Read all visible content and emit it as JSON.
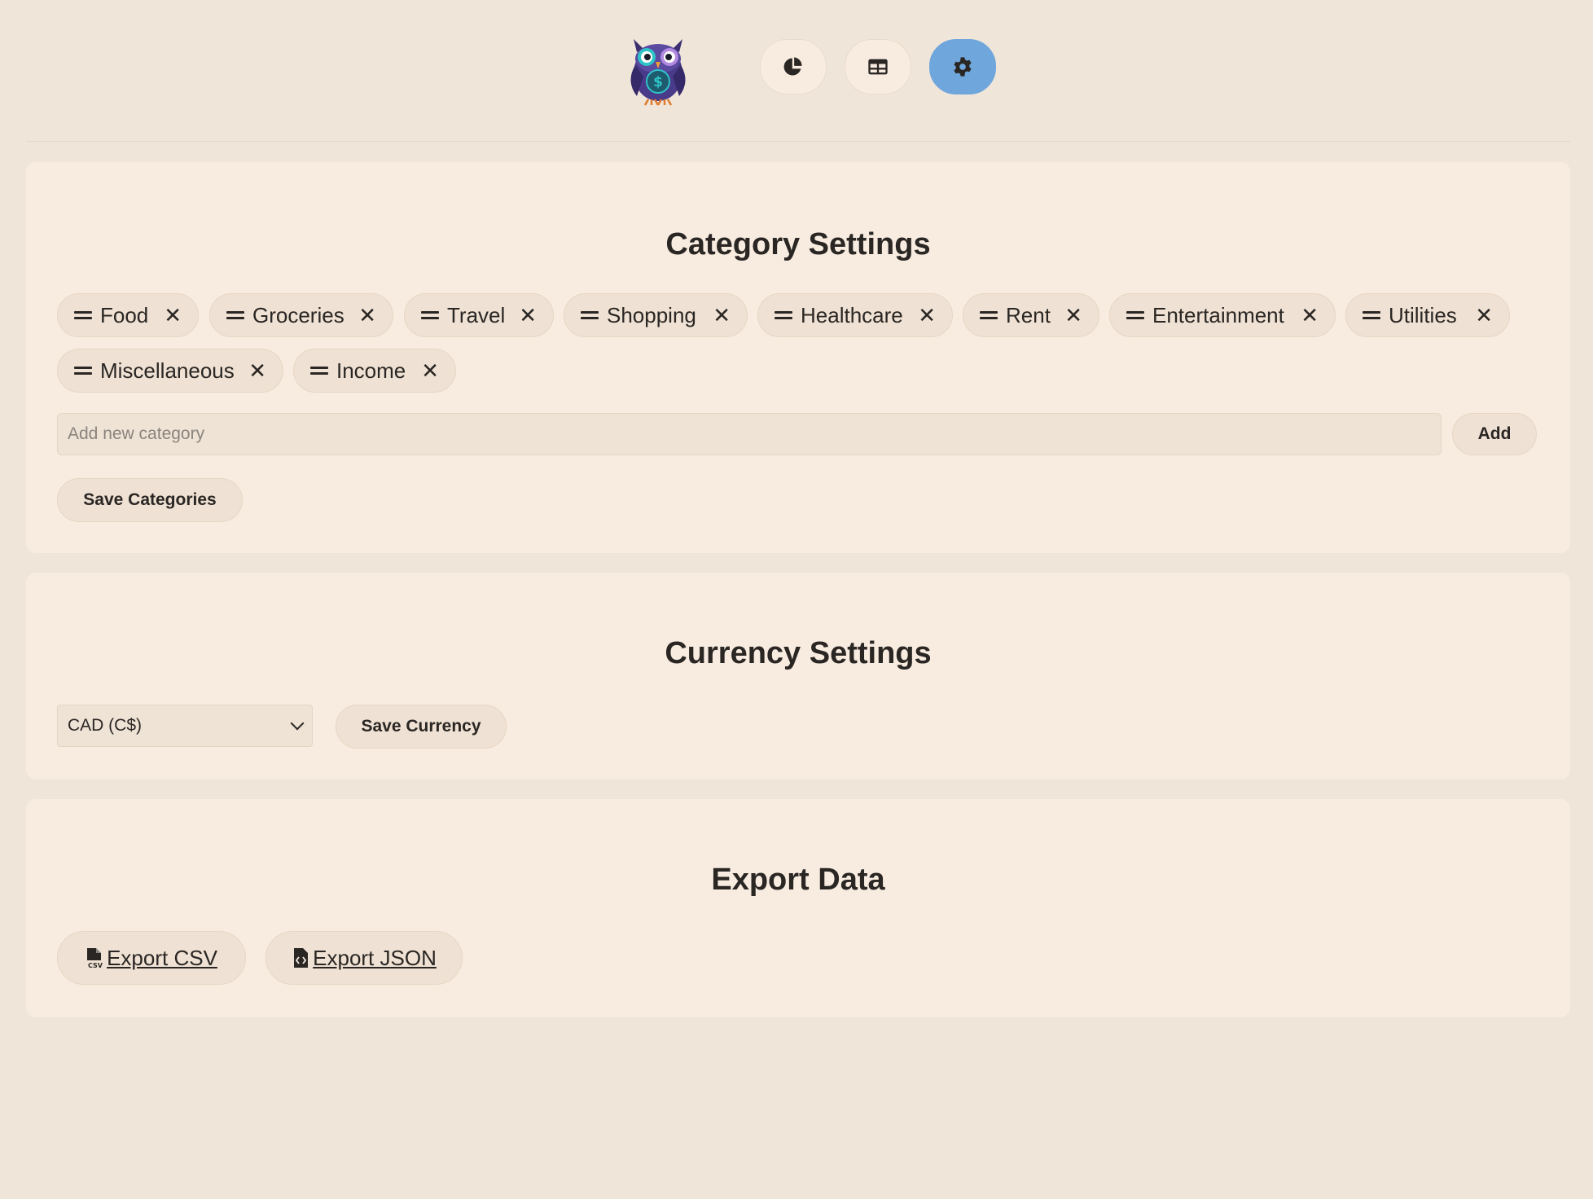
{
  "nav": {
    "items": [
      {
        "name": "dashboard",
        "icon": "pie-chart-icon"
      },
      {
        "name": "transactions",
        "icon": "table-icon"
      },
      {
        "name": "settings",
        "icon": "gear-icon",
        "active": true
      }
    ],
    "active_color": "#6fa6dc"
  },
  "category_settings": {
    "title": "Category Settings",
    "categories": [
      "Food",
      "Groceries",
      "Travel",
      "Shopping",
      "Healthcare",
      "Rent",
      "Entertainment",
      "Utilities",
      "Miscellaneous",
      "Income"
    ],
    "remove_glyph": "✕",
    "new_category_placeholder": "Add new category",
    "add_label": "Add",
    "save_label": "Save Categories"
  },
  "currency_settings": {
    "title": "Currency Settings",
    "selected": "CAD (C$)",
    "save_label": "Save Currency"
  },
  "export_data": {
    "title": "Export Data",
    "csv_label": "Export CSV",
    "json_label": "Export JSON"
  }
}
